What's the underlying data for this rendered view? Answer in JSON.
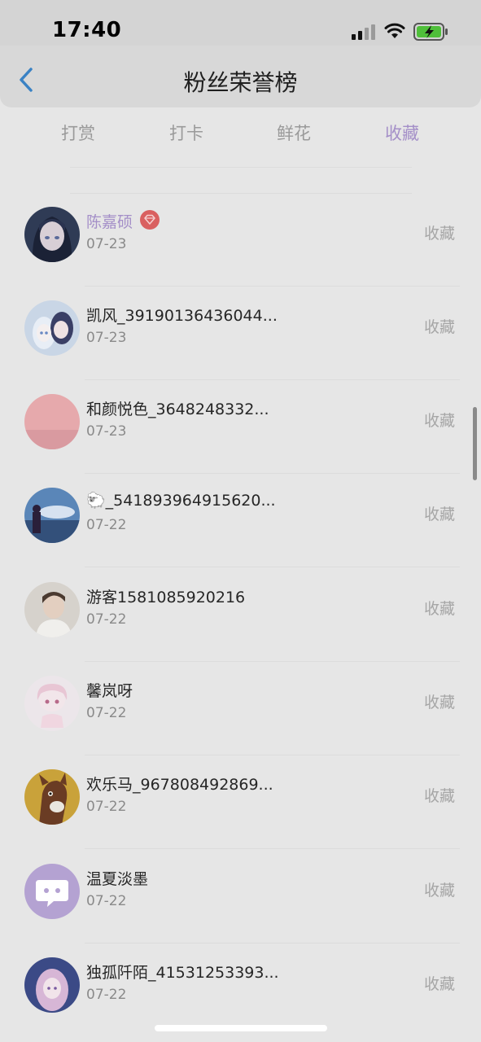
{
  "status_bar": {
    "time": "17:40"
  },
  "header": {
    "title": "粉丝荣誉榜"
  },
  "tabs": [
    {
      "label": "打赏",
      "active": false
    },
    {
      "label": "打卡",
      "active": false
    },
    {
      "label": "鲜花",
      "active": false
    },
    {
      "label": "收藏",
      "active": true
    }
  ],
  "colors": {
    "accent": "#a48fc8",
    "vip_badge": "#d96060"
  },
  "list": {
    "action_label": "收藏",
    "items": [
      {
        "name": "陈嘉硕",
        "date": "07-23",
        "vip": true,
        "avatar": "anime-girl-dark-hair-avatar"
      },
      {
        "name": "凯风_39190136436044...",
        "date": "07-23",
        "vip": false,
        "avatar": "anime-pair-avatar"
      },
      {
        "name": "和颜悦色_3648248332...",
        "date": "07-23",
        "vip": false,
        "avatar": "crescent-moon-pink-avatar"
      },
      {
        "name": "🐑_541893964915620...",
        "date": "07-22",
        "vip": false,
        "avatar": "night-sky-figure-avatar"
      },
      {
        "name": "游客1581085920216",
        "date": "07-22",
        "vip": false,
        "avatar": "boy-photo-avatar"
      },
      {
        "name": "馨岚呀",
        "date": "07-22",
        "vip": false,
        "avatar": "chibi-girl-avatar"
      },
      {
        "name": "欢乐马_967808492869...",
        "date": "07-22",
        "vip": false,
        "avatar": "cartoon-horse-avatar"
      },
      {
        "name": "温夏淡墨",
        "date": "07-22",
        "vip": false,
        "avatar": "chat-bubble-avatar"
      },
      {
        "name": "独孤阡陌_41531253393...",
        "date": "07-22",
        "vip": false,
        "avatar": "anime-girl-pink-avatar"
      }
    ]
  }
}
